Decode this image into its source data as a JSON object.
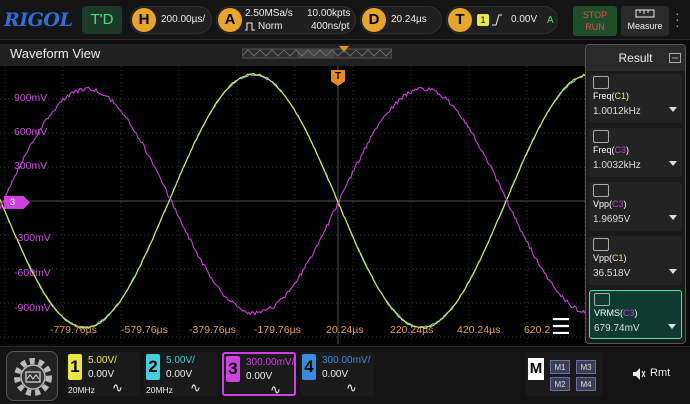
{
  "brand": "RIGOL",
  "topbar": {
    "mode": "T'D",
    "horizontal": {
      "badge": "H",
      "value": "200.00µs/"
    },
    "acquire": {
      "badge": "A",
      "rate": "2.50MSa/s",
      "mode": "Norm",
      "points": "10.00kpts",
      "per_pt": "400ns/pt"
    },
    "delay": {
      "badge": "D",
      "value": "20.24µs"
    },
    "trigger": {
      "badge": "T",
      "source": "1",
      "level": "0.00V",
      "mode": "A"
    },
    "stop_label": "STOP",
    "run_label": "RUN",
    "measure_label": "Measure"
  },
  "waveform": {
    "title": "Waveform View",
    "trigger_marker": "T",
    "ch3_marker": "3",
    "time_labels": [
      "-779.76µs",
      "-579.76µs",
      "-379.76µs",
      "-179.76µs",
      "20.24µs",
      "220.24µs",
      "420.24µs",
      "620.2"
    ],
    "volt_labels": [
      "900mV",
      "600mV",
      "300mV",
      "-300mV",
      "-600mV",
      "-900mV"
    ]
  },
  "result": {
    "title": "Result",
    "items": [
      {
        "name": "Freq",
        "src": "C1",
        "src_color": "#e8e840",
        "value": "1.0012kHz"
      },
      {
        "name": "Freq",
        "src": "C3",
        "src_color": "#c040d0",
        "value": "1.0032kHz"
      },
      {
        "name": "Vpp",
        "src": "C3",
        "src_color": "#c040d0",
        "value": "1.9695V"
      },
      {
        "name": "Vpp",
        "src": "C1",
        "src_color": "#e8e840",
        "value": "36.518V"
      },
      {
        "name": "VRMS",
        "src": "C3",
        "src_color": "#c040d0",
        "value": "679.74mV"
      }
    ]
  },
  "channels": [
    {
      "num": "1",
      "scale": "5.00V/",
      "offset": "0.00V",
      "bw": "20MHz",
      "color": "#e8e840"
    },
    {
      "num": "2",
      "scale": "5.00V/",
      "offset": "0.00V",
      "bw": "20MHz",
      "color": "#40d0e0"
    },
    {
      "num": "3",
      "scale": "300.00mV/",
      "offset": "0.00V",
      "bw": "",
      "color": "#d040e0"
    },
    {
      "num": "4",
      "scale": "300.00mV/",
      "offset": "0.00V",
      "bw": "",
      "color": "#3a8ae0"
    }
  ],
  "math": {
    "label": "M",
    "buttons": [
      "M1",
      "M3",
      "M2",
      "M4"
    ]
  },
  "remote": {
    "label": "Rmt"
  },
  "colors": {
    "ch1": "#e8e840",
    "ch2": "#40d0e0",
    "ch3": "#d040e0",
    "ch4": "#3a8ae0",
    "trigger": "#e88a20",
    "grid": "#3a3a3a"
  }
}
